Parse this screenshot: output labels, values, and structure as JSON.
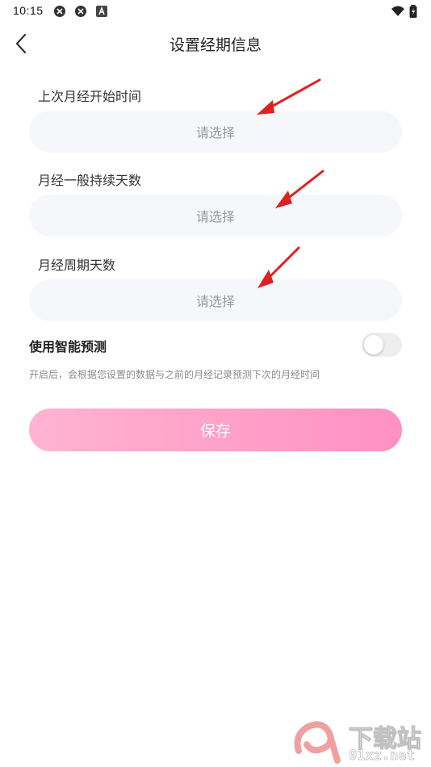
{
  "status_bar": {
    "time": "10:15",
    "icons": [
      "sync-icon",
      "sync-icon",
      "a-icon",
      "wifi-icon",
      "battery-icon"
    ]
  },
  "header": {
    "title": "设置经期信息",
    "back_icon": "chevron-left-icon"
  },
  "fields": [
    {
      "label": "上次月经开始时间",
      "placeholder": "请选择"
    },
    {
      "label": "月经一般持续天数",
      "placeholder": "请选择"
    },
    {
      "label": "月经周期天数",
      "placeholder": "请选择"
    }
  ],
  "prediction": {
    "label": "使用智能预测",
    "enabled": false,
    "hint": "开启后，会根据您设置的数据与之前的月经记录预测下次的月经时间"
  },
  "save_button": {
    "label": "保存"
  },
  "watermark": {
    "logo_text": "9f",
    "top_text": "下载站",
    "bottom_text": "91xz.net"
  },
  "colors": {
    "accent_pink": "#ff91c3",
    "accent_pink_light": "#ffb3d1",
    "annotation_red": "#e02020",
    "field_bg": "#f6f7fa"
  }
}
